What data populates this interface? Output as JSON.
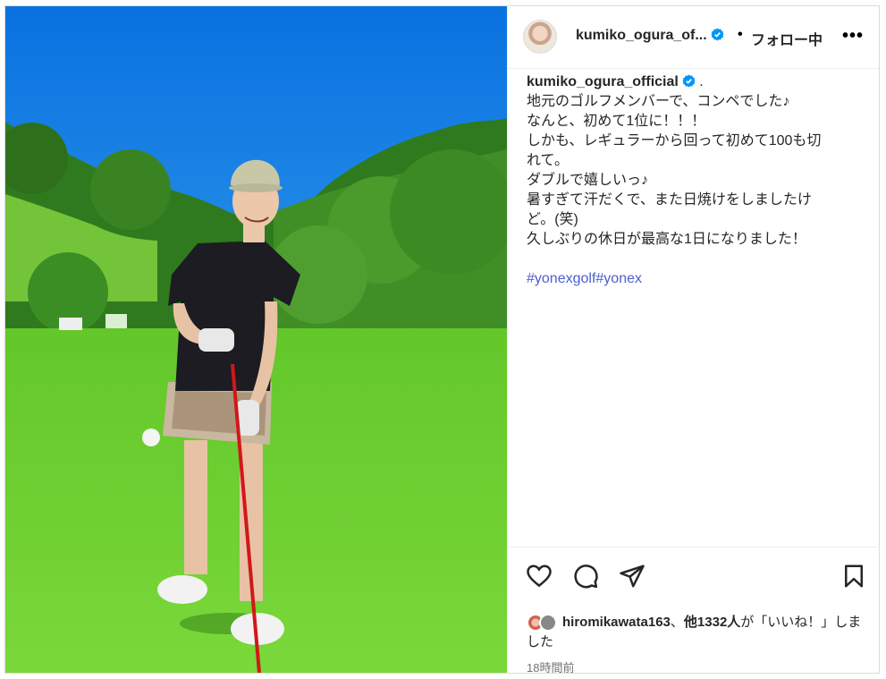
{
  "post": {
    "username": "kumiko_ogura_of...",
    "follow_label": "フォロー中",
    "more_label": "•••",
    "separator": "•"
  },
  "caption": {
    "username": "kumiko_ogura_official",
    "suffix": " .",
    "lines": [
      "地元のゴルフメンバーで、コンペでした♪",
      "なんと、初めて1位に！！！",
      "しかも、レギュラーから回って初めて100も切",
      "れて。",
      "ダブルで嬉しいっ♪",
      "暑すぎて汗だくで、また日焼けをしましたけ",
      "ど。(笑)",
      "久しぶりの休日が最高な1日になりました！"
    ],
    "hashtags": "#yonexgolf#yonex"
  },
  "likes": {
    "liker": "hiromikawata163",
    "joiner": "、",
    "others": "他1332人",
    "text_after": "が「いいね！」しました"
  },
  "timestamp": "18時間前",
  "colors": {
    "verified": "#0095f6",
    "hashtag": "#4a5fd0",
    "sky": "#1e8fe8",
    "grass": "#6fd12e"
  },
  "icons": [
    "heart-icon",
    "comment-icon",
    "share-icon",
    "bookmark-icon",
    "verified-badge-icon"
  ]
}
